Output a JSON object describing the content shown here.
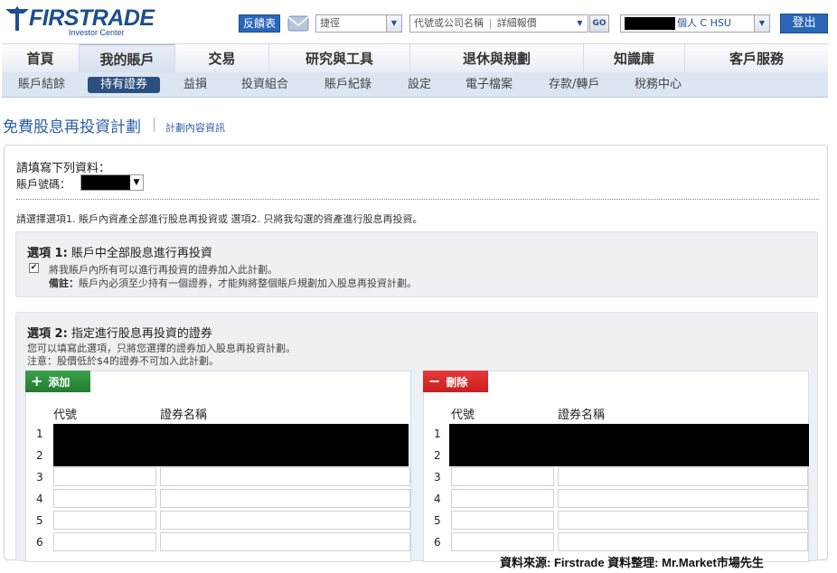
{
  "brand": {
    "name": "FIRSTRADE",
    "subtitle": "Investor Center"
  },
  "header": {
    "feedback_label": "反饋表",
    "quote_type_value": "捷徑",
    "symbol_placeholder": "代號或公司名稱",
    "detail_quote_label": "詳細報價",
    "go_label": "GO",
    "account_suffix": "個人 C HSU",
    "logout_label": "登出"
  },
  "main_nav": [
    {
      "label": "首頁"
    },
    {
      "label": "我的賬戶"
    },
    {
      "label": "交易"
    },
    {
      "label": "研究與工具"
    },
    {
      "label": "退休與規劃"
    },
    {
      "label": "知識庫"
    },
    {
      "label": "客戶服務"
    }
  ],
  "sub_nav": [
    {
      "label": "賬戶結餘"
    },
    {
      "label": "持有證券"
    },
    {
      "label": "益損"
    },
    {
      "label": "投資組合"
    },
    {
      "label": "賬戶紀錄"
    },
    {
      "label": "設定"
    },
    {
      "label": "電子檔案"
    },
    {
      "label": "存款/轉戶"
    },
    {
      "label": "稅務中心"
    }
  ],
  "page": {
    "title": "免費股息再投資計劃",
    "plan_link": "計劃內容資訊"
  },
  "form": {
    "heading": "請填寫下列資料：",
    "account_label": "賬戶號碼：",
    "instruction": "請選擇選項1. 賬戶內資產全部進行股息再投資或 選項2. 只將我勾選的資產進行股息再投資。",
    "option1": {
      "title_prefix": "選項 1:",
      "title_text": "賬戶中全部股息進行再投資",
      "checkbox_label": "將我賬戶內所有可以進行再投資的證券加入此計劃。",
      "note_label": "備註：",
      "note_text": "賬戶內必須至少持有一個證券，才能夠將整個賬戶規劃加入股息再投資計劃。",
      "checked": true
    },
    "option2": {
      "title_prefix": "選項 2:",
      "title_text": "指定進行股息再投資的證券",
      "desc1": "您可以填寫此選項，只將您選擇的證券加入股息再投資計劃。",
      "desc2": "注意：股價低於$4的證券不可加入此計劃。",
      "add_label": "添加",
      "delete_label": "刪除",
      "col_code": "代號",
      "col_name": "證券名稱",
      "rows": [
        "1",
        "2",
        "3",
        "4",
        "5",
        "6"
      ]
    }
  },
  "credit": "資料來源: Firstrade 資料整理: Mr.Market市場先生",
  "colors": {
    "brand_blue": "#1d4e8f",
    "active_subnav": "#2b4f7e",
    "add_green": "#2e8b3d",
    "delete_red": "#d92626"
  }
}
